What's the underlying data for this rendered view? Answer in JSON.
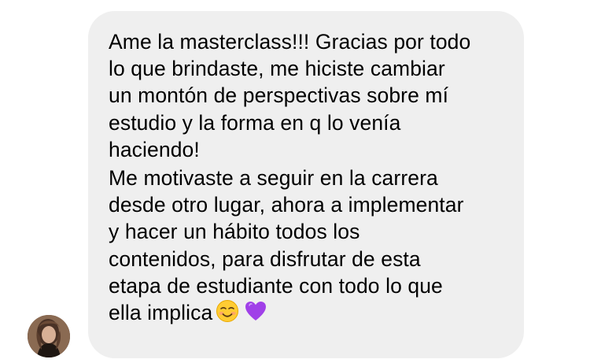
{
  "message": {
    "paragraphs": [
      {
        "lines": [
          "Ame la masterclass!!! Gracias por todo",
          "lo que brindaste, me hiciste cambiar",
          "un montón de perspectivas sobre mí",
          "estudio y la forma en q lo venía",
          "haciendo!"
        ]
      },
      {
        "lines": [
          "Me motivaste a seguir en la carrera",
          "desde otro lugar, ahora a implementar",
          "y hacer un hábito todos los",
          "contenidos, para disfrutar de esta",
          "etapa de estudiante con todo lo que",
          "ella implica"
        ]
      }
    ],
    "emojis": [
      "smiling-face-icon",
      "purple-heart-icon"
    ],
    "bubble_color": "#efefef",
    "text_color": "#000000"
  },
  "sender": {
    "avatar": "avatar"
  }
}
